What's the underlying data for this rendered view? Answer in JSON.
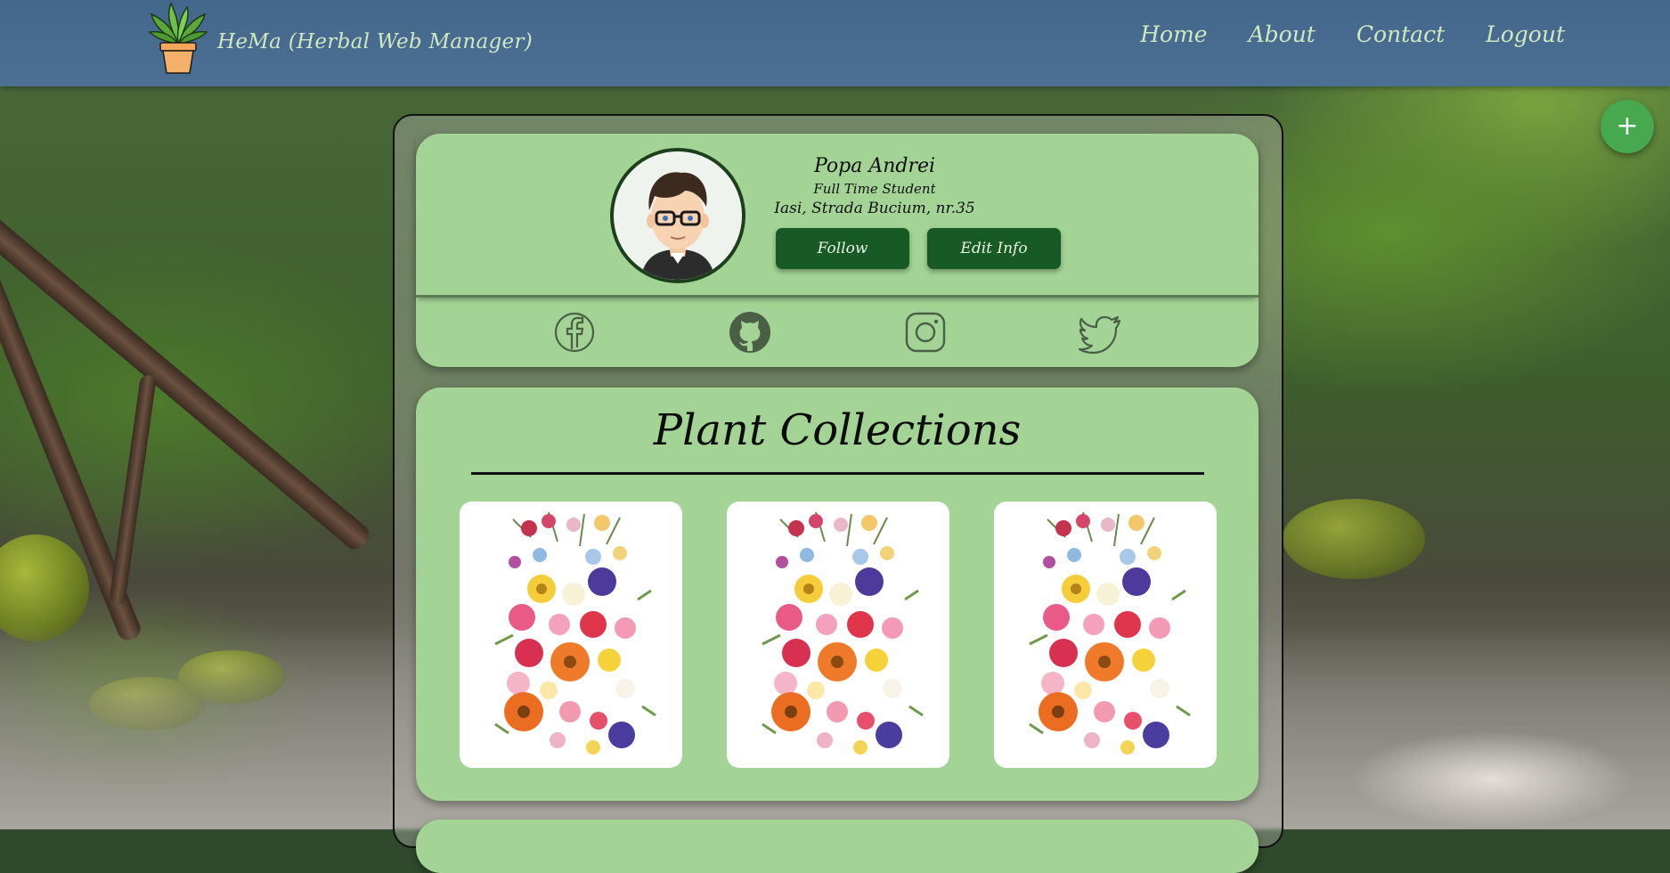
{
  "header": {
    "app_title": "HeMa (Herbal Web Manager)",
    "nav": [
      {
        "label": "Home"
      },
      {
        "label": "About"
      },
      {
        "label": "Contact"
      },
      {
        "label": "Logout"
      }
    ]
  },
  "profile": {
    "name": "Popa Andrei",
    "role": "Full Time Student",
    "address": "Iasi, Strada Bucium, nr.35",
    "follow_label": "Follow",
    "edit_label": "Edit Info",
    "socials": [
      "facebook-icon",
      "github-icon",
      "instagram-icon",
      "twitter-icon"
    ]
  },
  "collections": {
    "title": "Plant Collections",
    "items": [
      {
        "image": "pressed-flowers-image"
      },
      {
        "image": "pressed-flowers-image"
      },
      {
        "image": "pressed-flowers-image"
      }
    ]
  },
  "fab": {
    "label": "+"
  },
  "colors": {
    "header": "#4c6f93",
    "card": "#a4d495",
    "button": "#175a26",
    "fab": "#46a84f",
    "nav_text": "#cfe8c2"
  }
}
